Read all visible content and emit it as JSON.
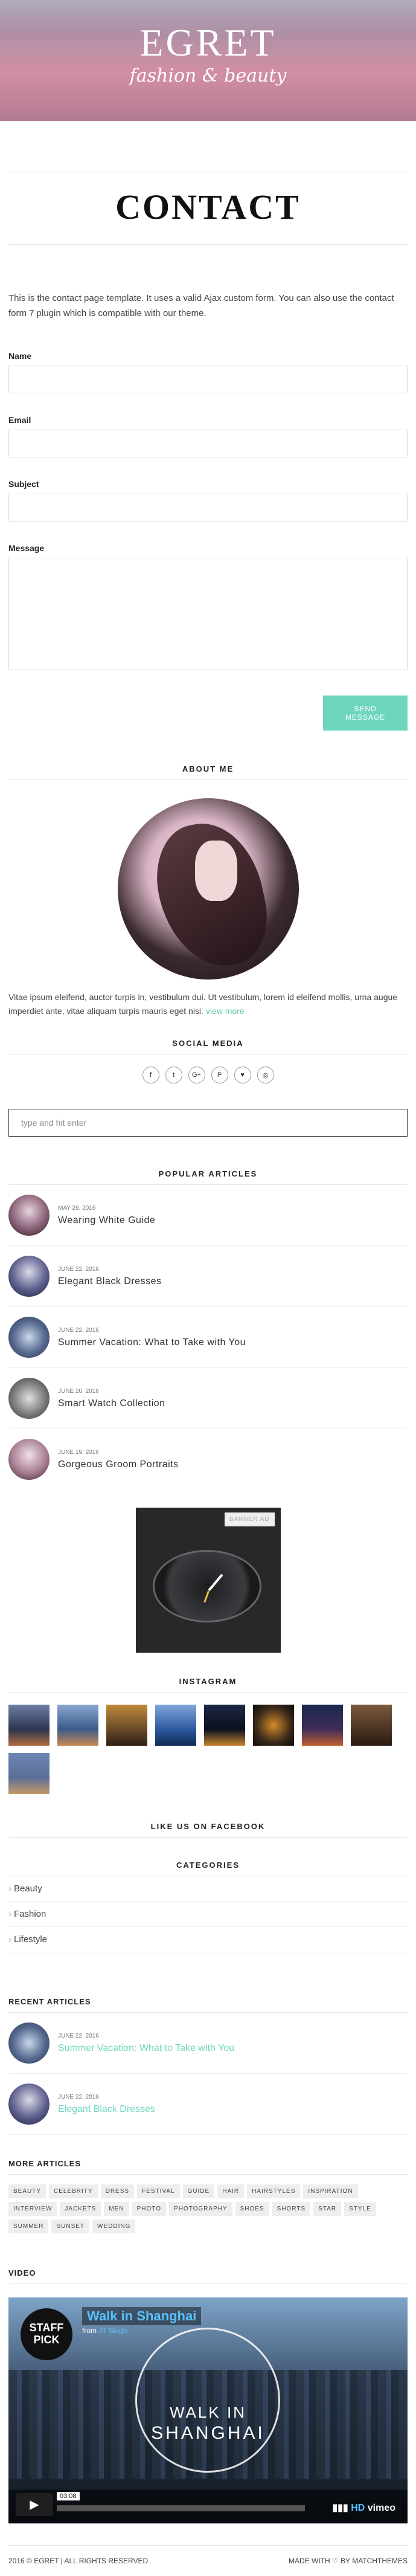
{
  "header": {
    "logo_title": "EGRET",
    "logo_subtitle": "fashion & beauty"
  },
  "page": {
    "title": "CONTACT",
    "intro": "This is the contact page template. It uses a valid Ajax custom form. You can also use the contact form 7 plugin which is compatible with our theme."
  },
  "form": {
    "name_label": "Name",
    "email_label": "Email",
    "subject_label": "Subject",
    "message_label": "Message",
    "send_label": "SEND MESSAGE"
  },
  "about": {
    "heading": "ABOUT ME",
    "text": "Vitae ipsum eleifend, auctor turpis in, vestibulum dui. Ut vestibulum, lorem id eleifend mollis, urna augue imperdiet ante, vitae aliquam turpis mauris eget nisi.",
    "more": "view more"
  },
  "social": {
    "heading": "SOCIAL MEDIA",
    "icons": [
      "f",
      "t",
      "G+",
      "P",
      "♥",
      "◎"
    ]
  },
  "search": {
    "placeholder": "type and hit enter"
  },
  "popular": {
    "heading": "POPULAR ARTICLES",
    "items": [
      {
        "date": "MAY 26, 2016",
        "title": "Wearing White Guide"
      },
      {
        "date": "JUNE 22, 2016",
        "title": "Elegant Black Dresses"
      },
      {
        "date": "JUNE 22, 2016",
        "title": "Summer Vacation: What to Take with You"
      },
      {
        "date": "JUNE 20, 2016",
        "title": "Smart Watch Collection"
      },
      {
        "date": "JUNE 19, 2016",
        "title": "Gorgeous Groom Portraits"
      }
    ]
  },
  "banner": {
    "label": "BANNER AD"
  },
  "instagram": {
    "heading": "INSTAGRAM"
  },
  "facebook": {
    "heading": "LIKE US ON FACEBOOK"
  },
  "categories": {
    "heading": "CATEGORIES",
    "items": [
      "Beauty",
      "Fashion",
      "Lifestyle"
    ]
  },
  "recent": {
    "heading": "RECENT ARTICLES",
    "items": [
      {
        "date": "JUNE 22, 2016",
        "title": "Summer Vacation: What to Take with You"
      },
      {
        "date": "JUNE 22, 2016",
        "title": "Elegant Black Dresses"
      }
    ]
  },
  "more_articles": {
    "heading": "MORE ARTICLES",
    "tags": [
      "BEAUTY",
      "CELEBRITY",
      "DRESS",
      "FESTIVAL",
      "GUIDE",
      "HAIR",
      "HAIRSTYLES",
      "INSPIRATION",
      "INTERVIEW",
      "JACKETS",
      "MEN",
      "PHOTO",
      "PHOTOGRAPHY",
      "SHOES",
      "SHORTS",
      "STAR",
      "STYLE",
      "SUMMER",
      "SUNSET",
      "WEDDING"
    ]
  },
  "video": {
    "heading": "VIDEO",
    "title": "Walk in Shanghai",
    "from_prefix": "from",
    "author": "JT Singh",
    "staff_pick": "STAFF PICK",
    "overlay_line1": "WALK IN",
    "overlay_line2": "SHANGHAI",
    "time": "03:08",
    "hd": "HD",
    "brand": "vimeo"
  },
  "footer": {
    "left": "2016 © EGRET | ALL RIGHTS RESERVED",
    "right": "MADE WITH ♡ BY MATCHTHEMES"
  }
}
